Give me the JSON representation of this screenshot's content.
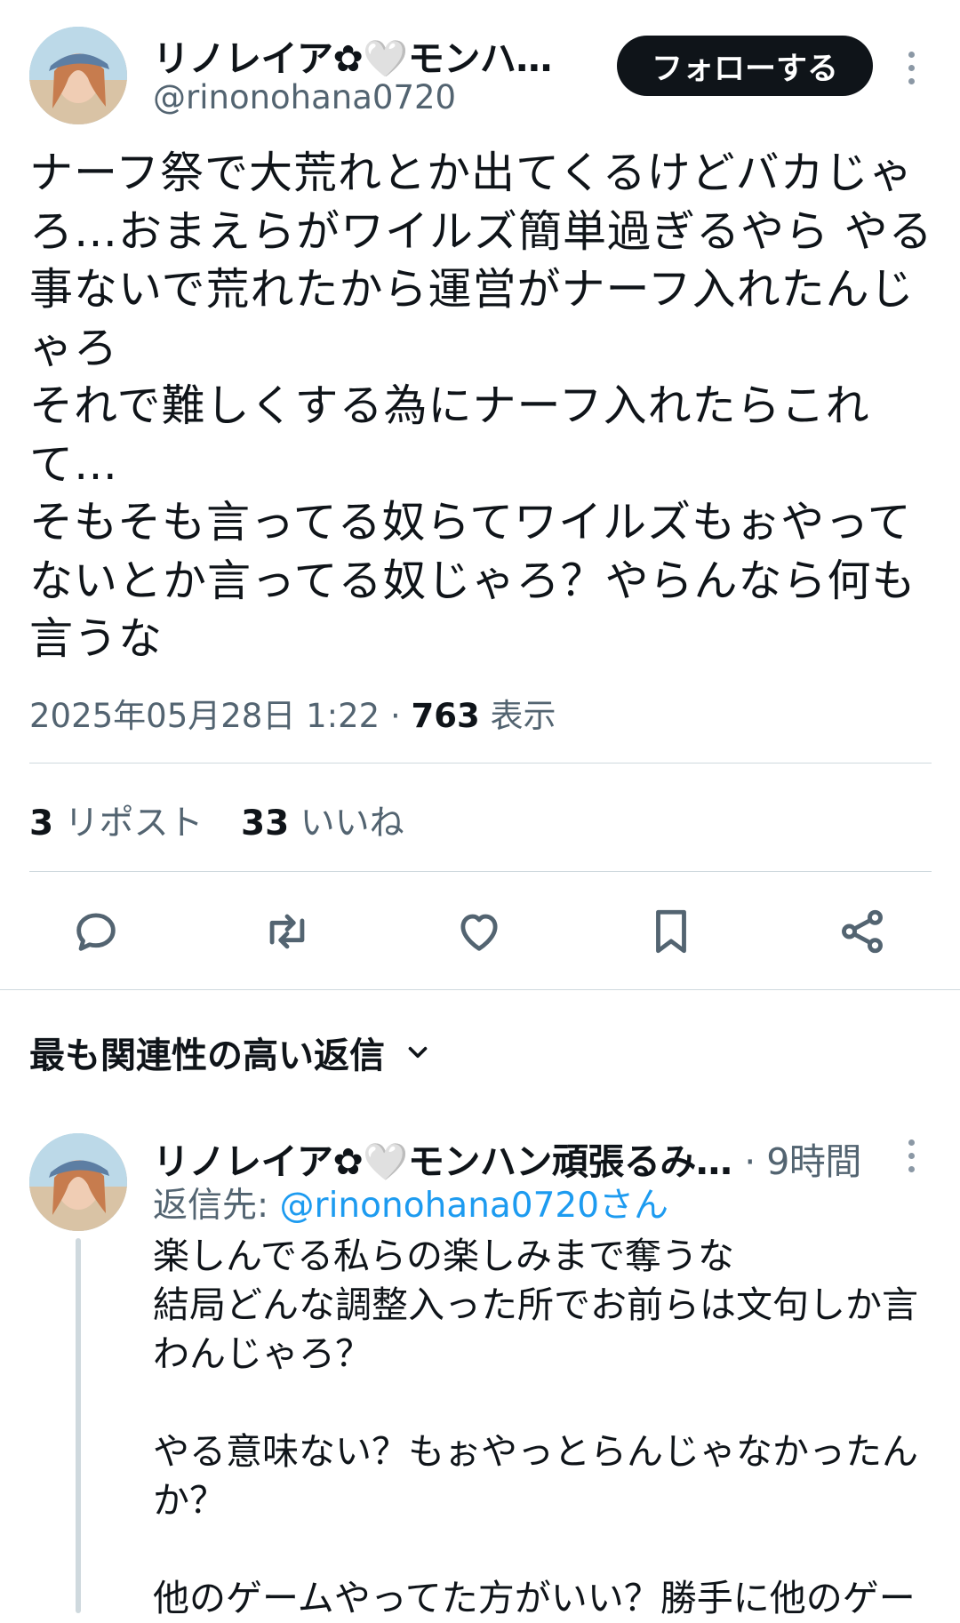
{
  "tweet": {
    "author_name": "リノレイア✿🤍モンハ…",
    "handle": "@rinonohana0720",
    "follow_label": "フォローする",
    "text": "ナーフ祭で大荒れとか出てくるけどバカじゃろ…おまえらがワイルズ簡単過ぎるやら やる事ないで荒れたから運営がナーフ入れたんじゃろ\nそれで難しくする為にナーフ入れたらこれて…\nそもそも言ってる奴らてワイルズもぉやってないとか言ってる奴じゃろ？やらんなら何も言うな",
    "date": "2025年05月28日 1:22",
    "separator": "·",
    "views": "763",
    "views_label": "表示",
    "reposts": "3",
    "reposts_label": "リポスト",
    "likes": "33",
    "likes_label": "いいね"
  },
  "actions": [
    {
      "icon": "reply-icon"
    },
    {
      "icon": "repost-icon"
    },
    {
      "icon": "like-icon"
    },
    {
      "icon": "bookmark-icon"
    },
    {
      "icon": "share-icon"
    }
  ],
  "sort": {
    "label": "最も関連性の高い返信",
    "icon": "chevron-down-icon"
  },
  "reply": {
    "author_name": "リノレイア✿🤍モンハン頑張るみ…",
    "time": "· 9時間",
    "reply_to_label": "返信先:",
    "reply_to_handle": "@rinonohana0720さん",
    "text": "楽しんでる私らの楽しみまで奪うな\n結局どんな調整入った所でお前らは文句しか言わんじゃろ？\n\nやる意味ない？もぉやっとらんじゃなかったんか？\n\n他のゲームやってた方がいい？勝手に他のゲー"
  },
  "colors": {
    "text": "#0f1419",
    "secondary": "#536471",
    "link": "#1d9bf0",
    "divider": "#cfd9de",
    "button_bg": "#0f1419"
  }
}
